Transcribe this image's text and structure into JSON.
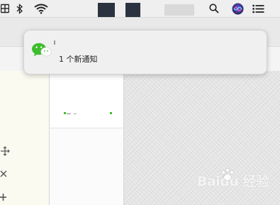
{
  "menubar": {
    "icons": [
      "app-icon",
      "bluetooth-icon",
      "wifi-icon",
      "search-icon",
      "siri-icon",
      "notification-center-icon"
    ]
  },
  "notification": {
    "app_icon": "wechat-icon",
    "message": "1 个新通知"
  },
  "sidebar": {
    "icons": [
      "move-icon",
      "close-icon",
      "add-icon"
    ]
  },
  "watermark": {
    "brand": "Baidu 经验"
  },
  "colors": {
    "wechat_green": "#3fbd2e",
    "menubar_bg": "#efefef",
    "dark_block": "#2b3340"
  }
}
